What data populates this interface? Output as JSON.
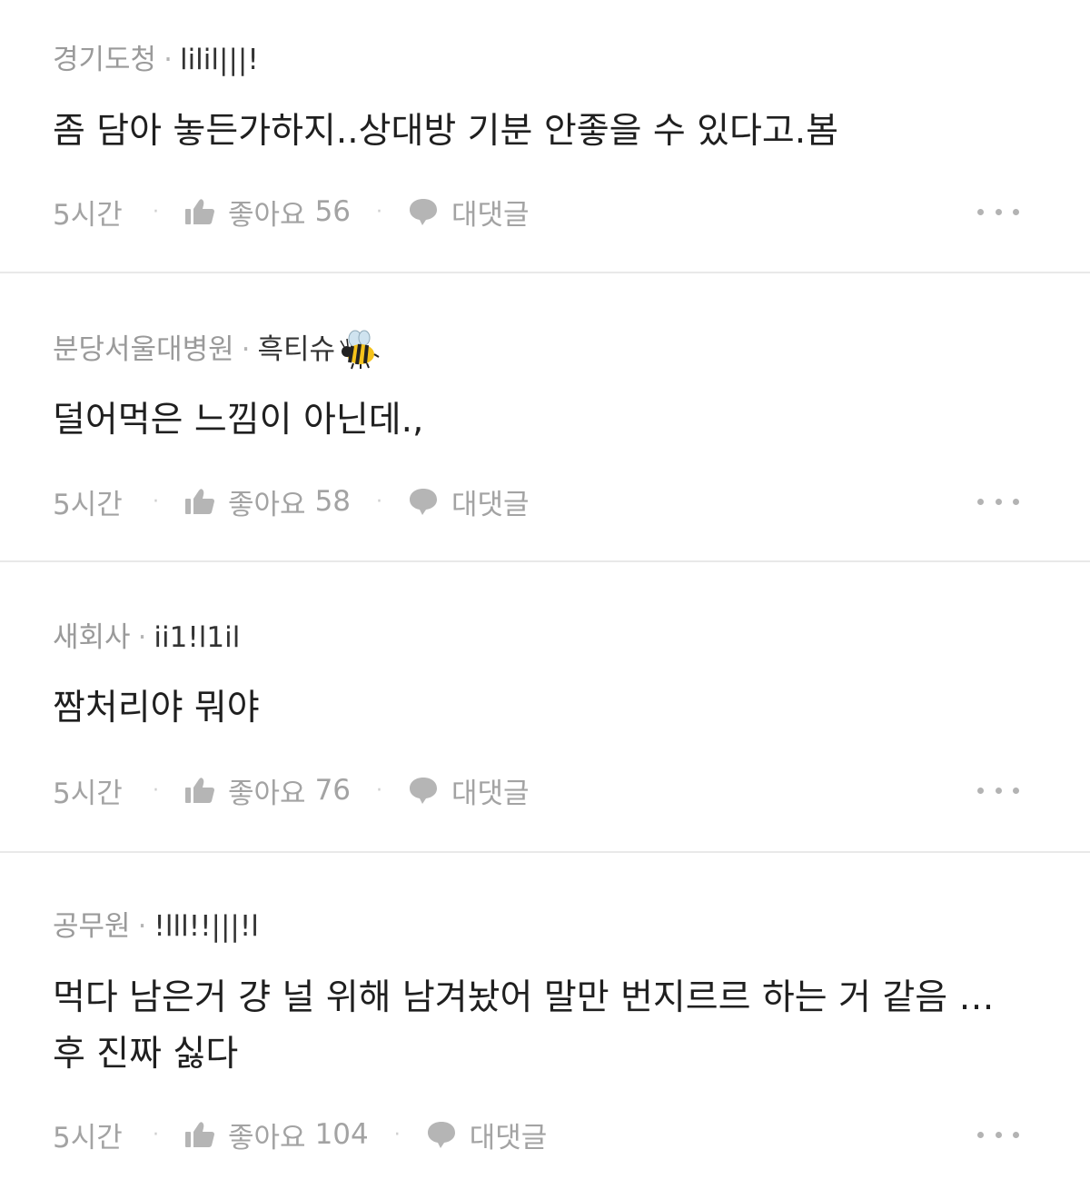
{
  "comments": [
    {
      "company": "경기도청",
      "separator": "·",
      "nickname": "lilil|||!",
      "text": "좀 담아 놓든가하지..상대방 기분 안좋을 수 있다고.봄",
      "time": "5시간",
      "like_label": "좋아요",
      "like_count": "56",
      "reply_label": "대댓글"
    },
    {
      "company": "분당서울대병원",
      "separator": "·",
      "nickname": "흑티슈",
      "text": "덜어먹은 느낌이 아닌데.,",
      "time": "5시간",
      "like_label": "좋아요",
      "like_count": "58",
      "reply_label": "대댓글"
    },
    {
      "company": "새회사",
      "separator": "·",
      "nickname": "ii1!l1il",
      "text": "짬처리야 뭐야",
      "time": "5시간",
      "like_label": "좋아요",
      "like_count": "76",
      "reply_label": "대댓글"
    },
    {
      "company": "공무원",
      "separator": "·",
      "nickname": "!lll!!|||!l",
      "text": "먹다 남은거 걍 널 위해 남겨놨어 말만 번지르르 하는 거 같음 …\n후 진짜 싫다",
      "time": "5시간",
      "like_label": "좋아요",
      "like_count": "104",
      "reply_label": "대댓글"
    }
  ],
  "icons": {
    "like": "thumbs-up-icon",
    "reply": "speech-bubble-icon",
    "more": "ellipsis-icon",
    "badge": "bee-icon"
  },
  "colors": {
    "meta_gray": "#9a9a9a",
    "icon_gray": "#b5b5b5",
    "divider": "#e9e9e9"
  }
}
